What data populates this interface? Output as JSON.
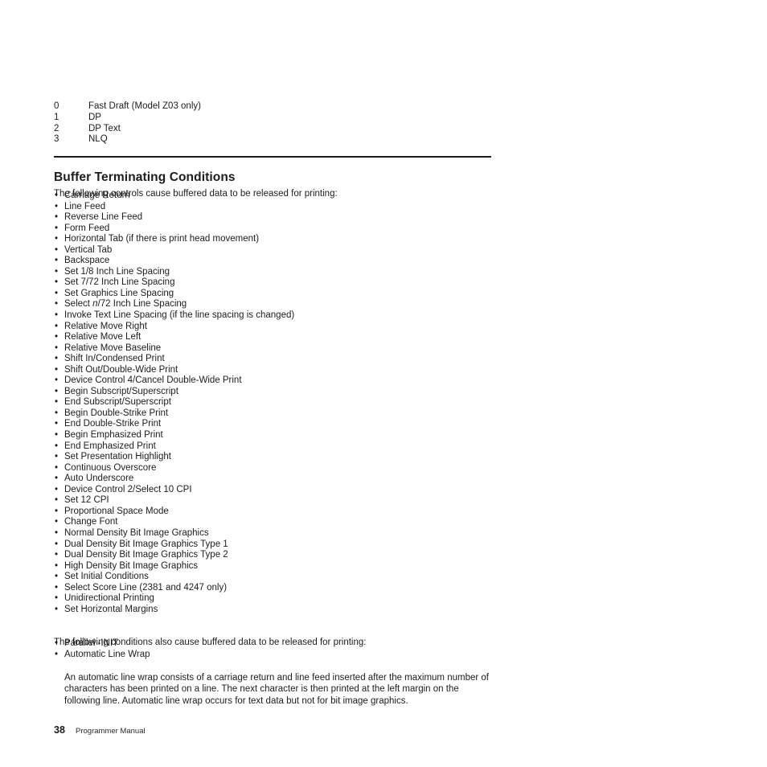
{
  "code_table": {
    "rows": [
      {
        "code": "0",
        "desc": "Fast Draft (Model Z03 only)"
      },
      {
        "code": "1",
        "desc": "DP"
      },
      {
        "code": "2",
        "desc": "DP Text"
      },
      {
        "code": "3",
        "desc": "NLQ"
      }
    ]
  },
  "section": {
    "title": "Buffer Terminating Conditions"
  },
  "intro_a": "The following controls cause buffered data to be released for printing:",
  "controls_list": [
    "Carriage Return",
    "Line Feed",
    "Reverse Line Feed",
    "Form Feed",
    "Horizontal Tab (if there is print head movement)",
    "Vertical Tab",
    "Backspace",
    "Set 1/8 Inch Line Spacing",
    "Set 7/72 Inch Line Spacing",
    "Set Graphics Line Spacing",
    "SELECT_N_72",
    "Invoke Text Line Spacing (if the line spacing is changed)",
    "Relative Move Right",
    "Relative Move Left",
    "Relative Move Baseline",
    "Shift In/Condensed Print",
    "Shift Out/Double-Wide Print",
    "Device Control 4/Cancel Double-Wide Print",
    "Begin Subscript/Superscript",
    "End Subscript/Superscript",
    "Begin Double-Strike Print",
    "End Double-Strike Print",
    "Begin Emphasized Print",
    "End Emphasized Print",
    "Set Presentation Highlight",
    "Continuous Overscore",
    "Auto Underscore",
    "Device Control 2/Select 10 CPI",
    "Set 12 CPI",
    "Proportional Space Mode",
    "Change Font",
    "Normal Density Bit Image Graphics",
    "Dual Density Bit Image Graphics Type 1",
    "Dual Density Bit Image Graphics Type 2",
    "High Density Bit Image Graphics",
    "Set Initial Conditions",
    "Select Score Line (2381 and 4247 only)",
    "Unidirectional Printing",
    "Set Horizontal Margins"
  ],
  "select_n_72": {
    "prefix": "Select ",
    "italic": "n",
    "suffix": "/72 Inch Line Spacing"
  },
  "intro_b": "The following conditions also cause buffered data to be released for printing:",
  "conditions_list": [
    "Parallel -INIT",
    "Automatic Line Wrap"
  ],
  "note_paragraph": "An automatic line wrap consists of a carriage return and line feed inserted after the maximum number of characters has been printed on a line. The next character is then printed at the left margin on the following line. Automatic line wrap occurs for text data but not for bit image graphics.",
  "bullet_glyph": "•",
  "footer": {
    "page_number": "38",
    "document_title": "Programmer Manual"
  },
  "colors": {
    "text": "#1c1c1c",
    "rule": "#1c1c1c",
    "background": "#ffffff"
  }
}
